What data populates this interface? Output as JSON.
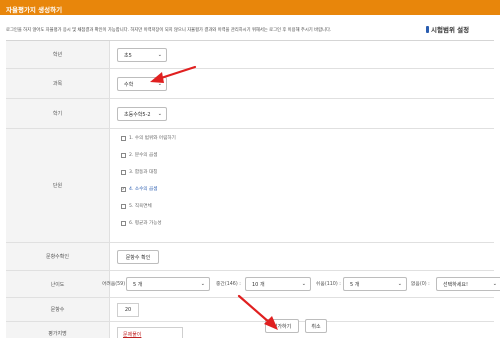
{
  "title": "자율평가지 생성하기",
  "notice": "로그인을 하지 않아도 자율평가 응시 및 채점결과 확인이 가능합니다. 하지만 이력저장이 되지 않으니 자율평가 결과와 이력을 관리하시기 위해서는 로그인 후 이용해 주시기 바랍니다.",
  "range_link": "시험범위 설정",
  "rows": {
    "grade": {
      "label": "학년",
      "value": "초5"
    },
    "subject": {
      "label": "과목",
      "value": "수학"
    },
    "semester": {
      "label": "학기",
      "value": "초등수학5-2"
    },
    "units": {
      "label": "단원",
      "items": [
        {
          "text": "1. 수의 범위와 어림하기",
          "checked": false
        },
        {
          "text": "2. 분수의 곱셈",
          "checked": false
        },
        {
          "text": "3. 합동과 대칭",
          "checked": false
        },
        {
          "text": "4. 소수의 곱셈",
          "checked": true
        },
        {
          "text": "5. 직육면체",
          "checked": false
        },
        {
          "text": "6. 평균과 가능성",
          "checked": false
        }
      ],
      "check_mark": "✓"
    },
    "count_check": {
      "label": "문항수확인",
      "button": "문항수 확인"
    },
    "difficulty": {
      "label": "난이도",
      "easy_label": "어려움(59) :",
      "easy_value": "5 개",
      "medium_label": "중간(146) :",
      "medium_value": "10 개",
      "hard_label": "쉬움(110) :",
      "hard_value": "5 개",
      "none_label": "없음(0) :",
      "none_value": "선택하세요!"
    },
    "question_count": {
      "label": "문항수",
      "value": "20"
    },
    "exam_name": {
      "label": "평가지명",
      "value": "문제풀이"
    }
  },
  "buttons": {
    "create": "평가하기",
    "cancel": "취소"
  },
  "colors": {
    "title_bar": "#e8860b",
    "arrow": "#e02020",
    "checked_text": "#2a5db0"
  },
  "icons": {
    "chevron": "chevron-down-icon",
    "pin": "pin-icon"
  }
}
